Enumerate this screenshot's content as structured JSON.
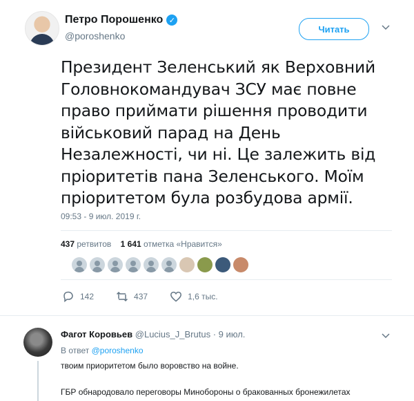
{
  "tweet": {
    "author_name": "Петро Порошенко",
    "author_handle": "@poroshenko",
    "follow_label": "Читать",
    "text": "Президент Зеленський як Верховний Головнокомандувач ЗСУ має повне право приймати рішення проводити військовий парад на День Незалежності, чи ні. Це залежить від пріоритетів пана Зеленського. Моїм пріоритетом була розбудова армії.",
    "timestamp": "09:53 - 9 июл. 2019 г.",
    "retweets_count": "437",
    "retweets_label": "ретвитов",
    "likes_count": "1 641",
    "likes_label": "отметка «Нравится»",
    "actions": {
      "replies": "142",
      "retweets": "437",
      "likes": "1,6 тыс."
    },
    "accent_color": "#1da1f2"
  },
  "reply": {
    "author_name": "Фагот Коровьев",
    "author_handle": "@Lucius_J_Brutus",
    "date": "· 9 июл.",
    "in_reply_prefix": "В ответ",
    "in_reply_handle": "@poroshenko",
    "text_line1": "твоим приоритетом было воровство на войне.",
    "text_line2": "ГБР обнародовало переговоры Минобороны о бракованных бронежилетах"
  }
}
